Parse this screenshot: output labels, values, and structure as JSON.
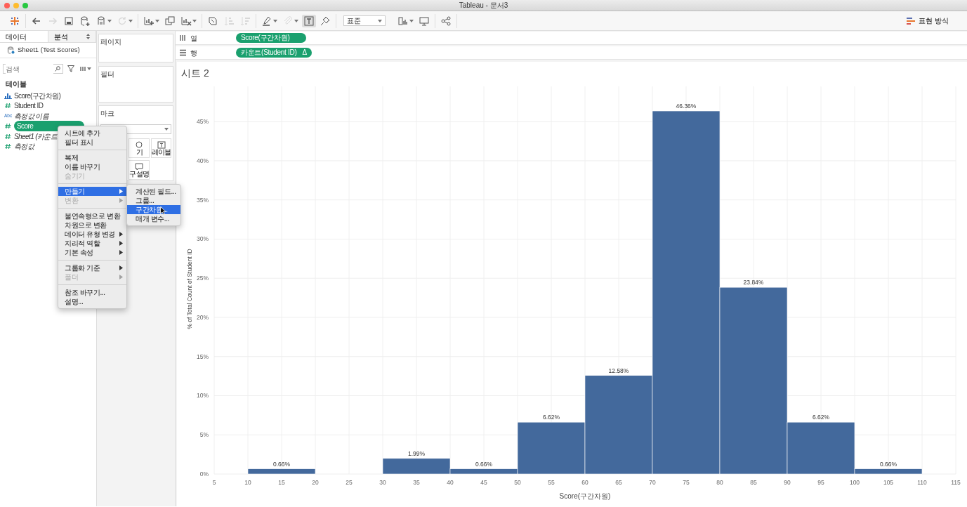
{
  "window": {
    "title": "Tableau - 문서3"
  },
  "toolbar": {
    "groups": [
      [
        {
          "kind": "logo",
          "disabled": false,
          "menu": false,
          "selected": false
        }
      ],
      [
        {
          "kind": "back",
          "disabled": false,
          "menu": false,
          "selected": false
        },
        {
          "kind": "forward",
          "disabled": true,
          "menu": false,
          "selected": false
        },
        {
          "kind": "save",
          "disabled": false,
          "menu": false,
          "selected": false
        },
        {
          "kind": "datasource",
          "disabled": false,
          "menu": false,
          "selected": false
        },
        {
          "kind": "pause",
          "disabled": false,
          "menu": true,
          "selected": false
        },
        {
          "kind": "refresh",
          "disabled": true,
          "menu": true,
          "selected": false
        }
      ],
      [
        {
          "kind": "new-sheet",
          "disabled": false,
          "menu": true,
          "selected": false
        },
        {
          "kind": "duplicate",
          "disabled": false,
          "menu": false,
          "selected": false
        },
        {
          "kind": "clear",
          "disabled": false,
          "menu": true,
          "selected": false
        }
      ],
      [
        {
          "kind": "swap",
          "disabled": false,
          "menu": false,
          "selected": false
        },
        {
          "kind": "sort-asc",
          "disabled": true,
          "menu": false,
          "selected": false
        },
        {
          "kind": "sort-desc",
          "disabled": true,
          "menu": false,
          "selected": false
        }
      ],
      [
        {
          "kind": "highlight",
          "disabled": false,
          "menu": true,
          "selected": false
        },
        {
          "kind": "attach",
          "disabled": true,
          "menu": true,
          "selected": false
        },
        {
          "kind": "labels",
          "disabled": false,
          "menu": false,
          "selected": true
        },
        {
          "kind": "pin",
          "disabled": false,
          "menu": false,
          "selected": false
        }
      ]
    ],
    "fit": "표준",
    "after_fit": [
      [
        {
          "kind": "cards",
          "disabled": false,
          "menu": true,
          "selected": false
        },
        {
          "kind": "presentation",
          "disabled": false,
          "menu": false,
          "selected": false
        }
      ],
      [
        {
          "kind": "share",
          "disabled": false,
          "menu": false,
          "selected": false
        }
      ]
    ],
    "show_me": "표현 방식"
  },
  "data_pane": {
    "tabs": [
      {
        "label": "데이터",
        "selected": true
      },
      {
        "label": "분석",
        "selected": false
      }
    ],
    "datasource": "Sheet1 (Test Scores)",
    "search": {
      "placeholder": "검색"
    },
    "section": "테이블",
    "fields": [
      {
        "name": "Score(구간차원)",
        "kind": "bin",
        "italic": false,
        "selected": false
      },
      {
        "name": "Student ID",
        "kind": "number",
        "italic": false,
        "selected": false
      },
      {
        "name": "측정값 이름",
        "kind": "text",
        "type_label": "Abc",
        "italic": true,
        "selected": false
      },
      {
        "name": "Score",
        "kind": "number",
        "italic": false,
        "selected": true
      },
      {
        "name": "Sheet1 (카운트",
        "kind": "number",
        "italic": true,
        "selected": false
      },
      {
        "name": "측정값",
        "kind": "number",
        "italic": true,
        "selected": false
      }
    ]
  },
  "cards": {
    "pages": "페이지",
    "filters": "필터",
    "marks": {
      "title": "마크",
      "buttons": [
        {
          "kind": "size",
          "label": "기"
        },
        {
          "kind": "label",
          "label": "레이블"
        },
        {
          "kind": "tooltip",
          "label": "구 설명"
        }
      ]
    }
  },
  "shelves": [
    {
      "kind": "columns",
      "label": "열",
      "pills": [
        {
          "text": "Score(구간차원)"
        }
      ]
    },
    {
      "kind": "rows",
      "label": "행",
      "pills": [
        {
          "text": "카운트(Student ID)",
          "badge": "Δ"
        }
      ]
    }
  ],
  "sheet": {
    "title": "시트 2",
    "chart_data": {
      "type": "bar",
      "grid": true,
      "xlabel": "Score(구간차원)",
      "ylabel": "% of Total Count of Student ID",
      "x": [
        15,
        35,
        45,
        55,
        65,
        75,
        85,
        95,
        105
      ],
      "values": [
        0.66,
        1.99,
        0.66,
        6.62,
        12.58,
        46.36,
        23.84,
        6.62,
        0.66
      ],
      "value_labels": [
        "0.66%",
        "1.99%",
        "0.66%",
        "6.62%",
        "12.58%",
        "46.36%",
        "23.84%",
        "6.62%",
        "0.66%"
      ],
      "xlim": [
        5,
        115
      ],
      "ylim": [
        0,
        49.5
      ],
      "xticks": [
        5,
        10,
        15,
        20,
        25,
        30,
        35,
        40,
        45,
        50,
        55,
        60,
        65,
        70,
        75,
        80,
        85,
        90,
        95,
        100,
        105,
        110,
        115
      ],
      "yticks": [
        {
          "value": 0,
          "label": "0%"
        },
        {
          "value": 5,
          "label": "5%"
        },
        {
          "value": 10,
          "label": "10%"
        },
        {
          "value": 15,
          "label": "15%"
        },
        {
          "value": 20,
          "label": "20%"
        },
        {
          "value": 25,
          "label": "25%"
        },
        {
          "value": 30,
          "label": "30%"
        },
        {
          "value": 35,
          "label": "35%"
        },
        {
          "value": 40,
          "label": "40%"
        },
        {
          "value": 45,
          "label": "45%"
        }
      ]
    }
  },
  "context_menu": {
    "sections": [
      [
        {
          "label": "시트에 추가",
          "disabled": false,
          "submenu": false,
          "selected": false
        },
        {
          "label": "필터 표시",
          "disabled": false,
          "submenu": false,
          "selected": false
        }
      ],
      [
        {
          "label": "복제",
          "disabled": false,
          "submenu": false,
          "selected": false
        },
        {
          "label": "이름 바꾸기",
          "disabled": false,
          "submenu": false,
          "selected": false
        },
        {
          "label": "숨기기",
          "disabled": true,
          "submenu": false,
          "selected": false
        }
      ],
      [
        {
          "label": "만들기",
          "disabled": false,
          "submenu": true,
          "selected": true
        },
        {
          "label": "변환",
          "disabled": true,
          "submenu": true,
          "selected": false
        }
      ],
      [
        {
          "label": "불연속형으로 변환",
          "disabled": false,
          "submenu": false,
          "selected": false
        },
        {
          "label": "차원으로 변환",
          "disabled": false,
          "submenu": false,
          "selected": false
        },
        {
          "label": "데이터 유형 변경",
          "disabled": false,
          "submenu": true,
          "selected": false
        },
        {
          "label": "지리적 역할",
          "disabled": false,
          "submenu": true,
          "selected": false
        },
        {
          "label": "기본 속성",
          "disabled": false,
          "submenu": true,
          "selected": false
        }
      ],
      [
        {
          "label": "그룹화 기준",
          "disabled": false,
          "submenu": true,
          "selected": false
        },
        {
          "label": "폴더",
          "disabled": true,
          "submenu": true,
          "selected": false
        }
      ],
      [
        {
          "label": "참조 바꾸기...",
          "disabled": false,
          "submenu": false,
          "selected": false
        },
        {
          "label": "설명...",
          "disabled": false,
          "submenu": false,
          "selected": false
        }
      ]
    ]
  },
  "submenu": {
    "items": [
      {
        "label": "계산된 필드...",
        "selected": false
      },
      {
        "label": "그룹...",
        "selected": false
      },
      {
        "label": "구간차원...",
        "selected": true
      },
      {
        "label": "매개 변수...",
        "selected": false
      }
    ]
  }
}
